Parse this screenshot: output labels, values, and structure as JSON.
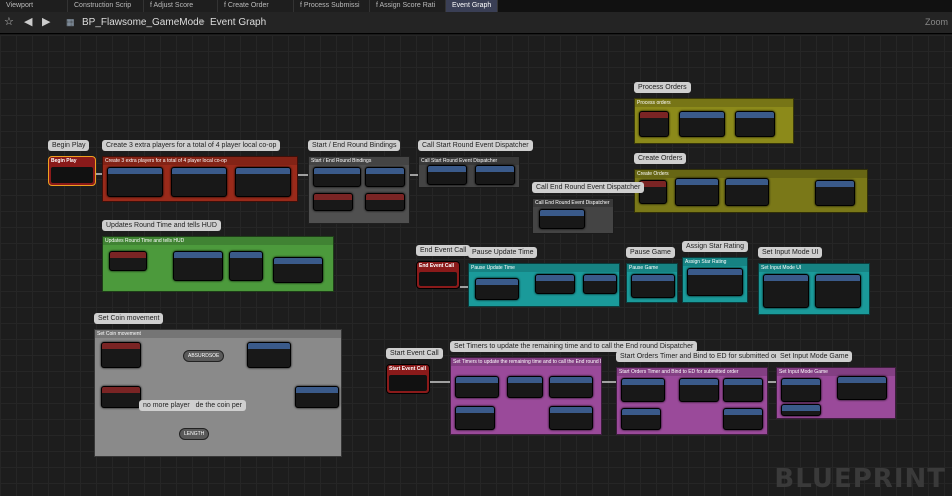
{
  "tabs": [
    {
      "label": "Viewport",
      "active": false
    },
    {
      "label": "Construction Scrip",
      "active": false
    },
    {
      "label": "f  Adjust Score",
      "active": false
    },
    {
      "label": "f  Create Order",
      "active": false
    },
    {
      "label": "f  Process Submissi",
      "active": false
    },
    {
      "label": "f  Assign Score Rati",
      "active": false
    },
    {
      "label": "Event Graph",
      "active": true
    }
  ],
  "breadcrumb": {
    "blueprint": "BP_Flawsome_GameMode",
    "separator": ">",
    "graph": "Event Graph"
  },
  "zoom_label": "Zoom",
  "watermark": "BLUEPRINT",
  "comments": {
    "process_orders": {
      "bubble": "Process Orders",
      "header": "Process orders",
      "color": "#8c8a1a"
    },
    "create_orders": {
      "bubble": "Create Orders",
      "header": "Create Orders",
      "color": "#7a7818"
    },
    "begin_play": {
      "bubble": "Begin Play",
      "header": "Begin Play"
    },
    "create_players": {
      "bubble": "Create 3 extra players for a total of 4 player local co-op",
      "header": "Create 3 extra players for a total of 4 player local co-op",
      "color": "#9a2a1a"
    },
    "start_end_bindings": {
      "bubble": "Start / End Round Bindings",
      "header": "Start / End Round Bindings",
      "color": "#505050"
    },
    "call_start_round": {
      "bubble": "Call Start Round Event Dispatcher",
      "header": "Call Start Round Event Dispatcher",
      "color": "#444444"
    },
    "call_end_round": {
      "bubble": "Call End Round Event Dispatcher",
      "header": "Call End Round Event Dispatcher",
      "color": "#444444"
    },
    "updates_round_time": {
      "bubble": "Updates Round Time and tells HUD",
      "header": "Updates Round Time and tells HUD",
      "color": "#4c9a3c"
    },
    "end_event_call": {
      "bubble": "End Event Call",
      "header": "End Event Call"
    },
    "pause_update_time": {
      "bubble": "Pause Update Time",
      "header": "Pause Update Time",
      "color": "#1a9a9a"
    },
    "pause_game": {
      "bubble": "Pause Game",
      "header": "Pause Game",
      "color": "#1a9a9a"
    },
    "assign_star_rating": {
      "bubble": "Assign Star Rating",
      "header": "Assign Star Rating",
      "color": "#1a9a9a"
    },
    "set_input_mode_ui": {
      "bubble": "Set Input Mode UI",
      "header": "Set Input Mode UI",
      "color": "#1a9a9a"
    },
    "set_coin_movement": {
      "bubble": "Set Coin movement",
      "header": "Set Coin movement",
      "color": "#8a8a8a"
    },
    "start_event_call": {
      "bubble": "Start Event Call",
      "header": "Start Event Call"
    },
    "set_timers": {
      "bubble": "Set Timers to update the remaining time and to call the End round Dispatcher",
      "header": "Set Timers to update the remaining time and to call the End round Dispatcher",
      "color": "#9a4a9a"
    },
    "start_orders_timer": {
      "bubble": "Start Orders Timer and Bind to ED for submitted order",
      "header": "Start Orders Timer and Bind to ED for submitted order",
      "color": "#9a4a9a"
    },
    "set_input_mode_game": {
      "bubble": "Set Input Mode Game",
      "header": "Set Input Mode Game",
      "color": "#9a4a9a"
    }
  },
  "coin_note": "no more player",
  "coin_note2": "de the coin per",
  "inline_labels": {
    "absurd": "ABSURDSOE",
    "length": "LENGTH"
  }
}
